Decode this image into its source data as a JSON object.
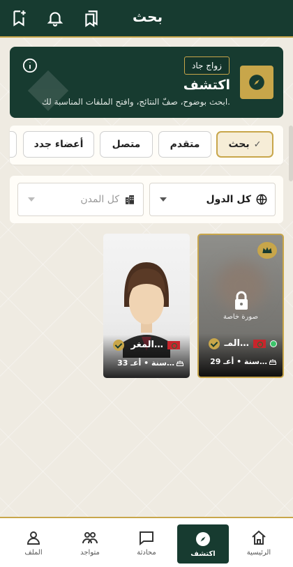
{
  "header": {
    "title": "بحث"
  },
  "hero": {
    "badge": "زواج جاد",
    "title": "اكتشف",
    "subtitle": "ابحث بوضوح، صفّ النتائج، وافتح الملفات المناسبة لك."
  },
  "chips": [
    "بحث",
    "متقدم",
    "متصل",
    "أعضاء جدد"
  ],
  "filters": {
    "country": "كل الدول",
    "city_placeholder": "كل المدن"
  },
  "profiles": [
    {
      "name": "المـ…",
      "age": "29 سنة",
      "extra": "أعـ…",
      "private_label": "صورة خاصة",
      "online": true,
      "premium": true
    },
    {
      "name": "المغر…",
      "age": "33 سنة",
      "extra": "أعـ…",
      "online": false,
      "premium": false
    }
  ],
  "nav": {
    "home": "الرئيسية",
    "discover": "اكتشف",
    "chat": "محادثة",
    "online": "متواجد",
    "profile": "الملف"
  },
  "colors": {
    "primary": "#173b30",
    "accent": "#c8a64a"
  }
}
